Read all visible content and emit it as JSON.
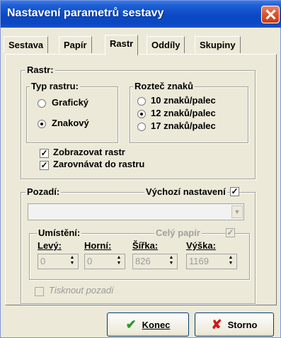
{
  "window": {
    "title": "Nastavení parametrů sestavy"
  },
  "tabs": [
    {
      "label": "Sestava",
      "active": false
    },
    {
      "label": "Papír",
      "active": false
    },
    {
      "label": "Rastr",
      "active": true
    },
    {
      "label": "Oddíly",
      "active": false
    },
    {
      "label": "Skupiny",
      "active": false
    }
  ],
  "raster": {
    "group_title": "Rastr:",
    "type_group_title": "Typ rastru:",
    "type_options": [
      {
        "label": "Grafický",
        "checked": false
      },
      {
        "label": "Znakový",
        "checked": true
      }
    ],
    "spacing_group_title": "Rozteč znaků",
    "spacing_options": [
      {
        "label": "10 znaků/palec",
        "checked": false
      },
      {
        "label": "12 znaků/palec",
        "checked": true
      },
      {
        "label": "17 znaků/palec",
        "checked": false
      }
    ],
    "show_raster_label": "Zobrazovat rastr",
    "show_raster_checked": true,
    "align_raster_label": "Zarovnávat do rastru",
    "align_raster_checked": true
  },
  "background": {
    "group_title": "Pozadí:",
    "default_settings_label": "Výchozí nastavení",
    "default_settings_checked": true,
    "combo_value": "",
    "placement_title": "Umístění:",
    "full_paper_label": "Celý papír",
    "full_paper_checked": true,
    "fields": [
      {
        "label": "Levý:",
        "value": "0"
      },
      {
        "label": "Horní:",
        "value": "0"
      },
      {
        "label": "Šířka:",
        "value": "826"
      },
      {
        "label": "Výška:",
        "value": "1169"
      }
    ],
    "print_background_label": "Tisknout pozadí",
    "print_background_checked": false
  },
  "buttons": {
    "ok_label": "Konec",
    "cancel_label": "Storno"
  },
  "colors": {
    "title_bar": "#0a49c5",
    "close_button": "#d8532f",
    "ok_icon": "#2a9a2a",
    "cancel_icon": "#cc1a1a"
  }
}
